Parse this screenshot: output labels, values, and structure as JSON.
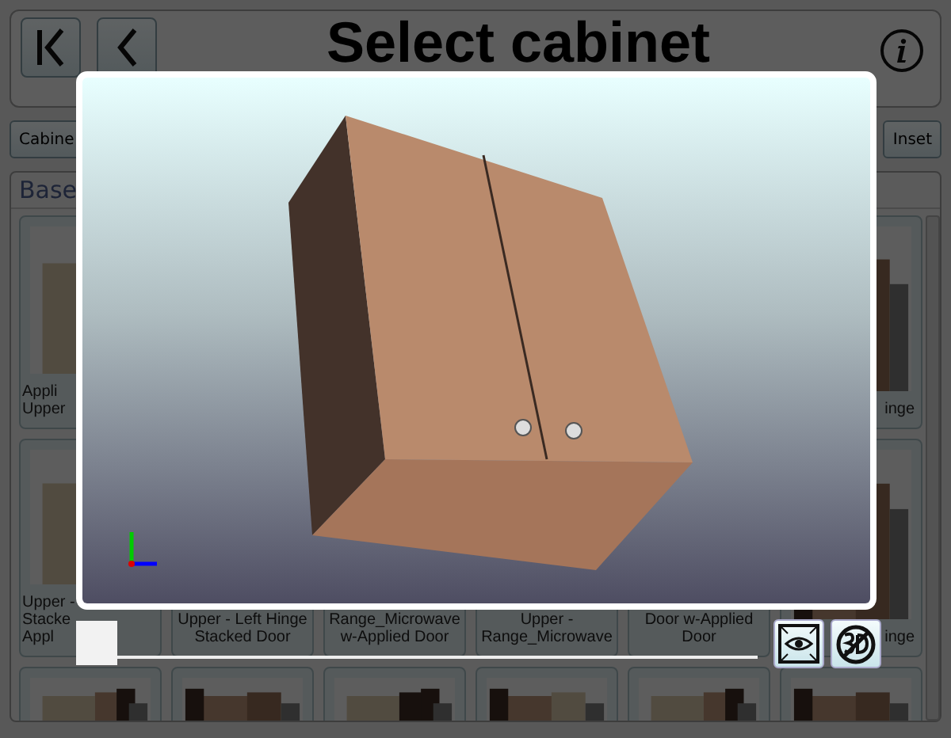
{
  "header": {
    "title": "Select cabinet"
  },
  "toolbar": {
    "left_button": "Cabine",
    "right_button": "Inset"
  },
  "section": {
    "title": "Base"
  },
  "tile_rows": [
    [
      {
        "kind": "picture",
        "lines": [
          "Appli",
          "Upper"
        ]
      },
      {},
      {},
      {},
      {},
      {
        "kind": "picture",
        "lines": [
          "inge"
        ]
      }
    ],
    [
      {
        "kind": "picture",
        "lines": [
          "Upper -",
          "Stacke",
          "Appl"
        ]
      },
      {
        "lines": [
          "Upper - Left Hinge",
          "Stacked Door"
        ]
      },
      {
        "lines": [
          "Range_Microwave",
          "w-Applied Door"
        ]
      },
      {
        "lines": [
          "Upper -",
          "Range_Microwave"
        ]
      },
      {
        "lines": [
          "Door w-Applied",
          "Door"
        ]
      },
      {
        "kind": "picture",
        "lines": [
          "inge"
        ]
      }
    ],
    [
      {
        "kind": "picture"
      },
      {
        "kind": "picture"
      },
      {
        "kind": "picture"
      },
      {
        "kind": "picture"
      },
      {
        "kind": "picture"
      },
      {
        "kind": "picture"
      }
    ]
  ],
  "viewer": {
    "slider": {
      "level": 0
    }
  }
}
